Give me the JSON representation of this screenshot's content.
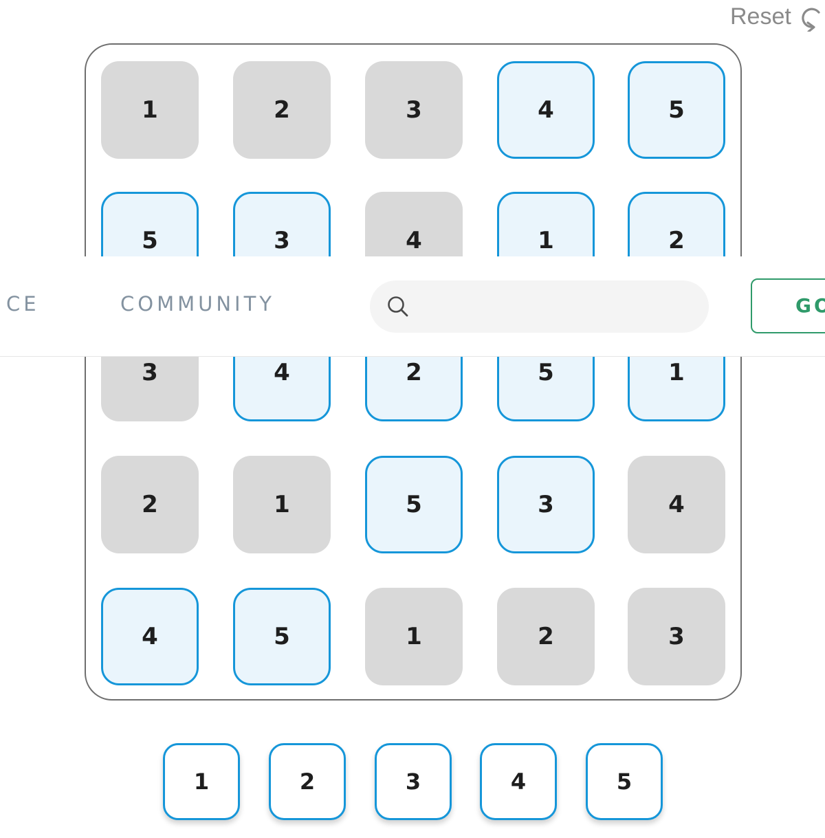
{
  "reset": {
    "label": "Reset",
    "icon": "reset-icon"
  },
  "board": {
    "rows": [
      [
        {
          "value": "1",
          "editable": false
        },
        {
          "value": "2",
          "editable": false
        },
        {
          "value": "3",
          "editable": false
        },
        {
          "value": "4",
          "editable": true
        },
        {
          "value": "5",
          "editable": true
        }
      ],
      [
        {
          "value": "5",
          "editable": true
        },
        {
          "value": "3",
          "editable": true
        },
        {
          "value": "4",
          "editable": false
        },
        {
          "value": "1",
          "editable": true
        },
        {
          "value": "2",
          "editable": true
        }
      ],
      [
        {
          "value": "3",
          "editable": false
        },
        {
          "value": "4",
          "editable": true
        },
        {
          "value": "2",
          "editable": true
        },
        {
          "value": "5",
          "editable": true
        },
        {
          "value": "1",
          "editable": true
        }
      ],
      [
        {
          "value": "2",
          "editable": false
        },
        {
          "value": "1",
          "editable": false
        },
        {
          "value": "5",
          "editable": true
        },
        {
          "value": "3",
          "editable": true
        },
        {
          "value": "4",
          "editable": false
        }
      ],
      [
        {
          "value": "4",
          "editable": true
        },
        {
          "value": "5",
          "editable": true
        },
        {
          "value": "1",
          "editable": false
        },
        {
          "value": "2",
          "editable": false
        },
        {
          "value": "3",
          "editable": false
        }
      ]
    ]
  },
  "palette": [
    "1",
    "2",
    "3",
    "4",
    "5"
  ],
  "nav": {
    "items": [
      "CE",
      "COMMUNITY"
    ],
    "search": {
      "placeholder": "",
      "value": "",
      "icon": "search-icon"
    },
    "go_label": "GO"
  },
  "colors": {
    "given_cell": "#d9d9d9",
    "editable_cell_fill": "#eaf5fc",
    "editable_cell_border": "#1596d9",
    "go_accent": "#2f9a6a",
    "nav_text": "#8392a0"
  }
}
